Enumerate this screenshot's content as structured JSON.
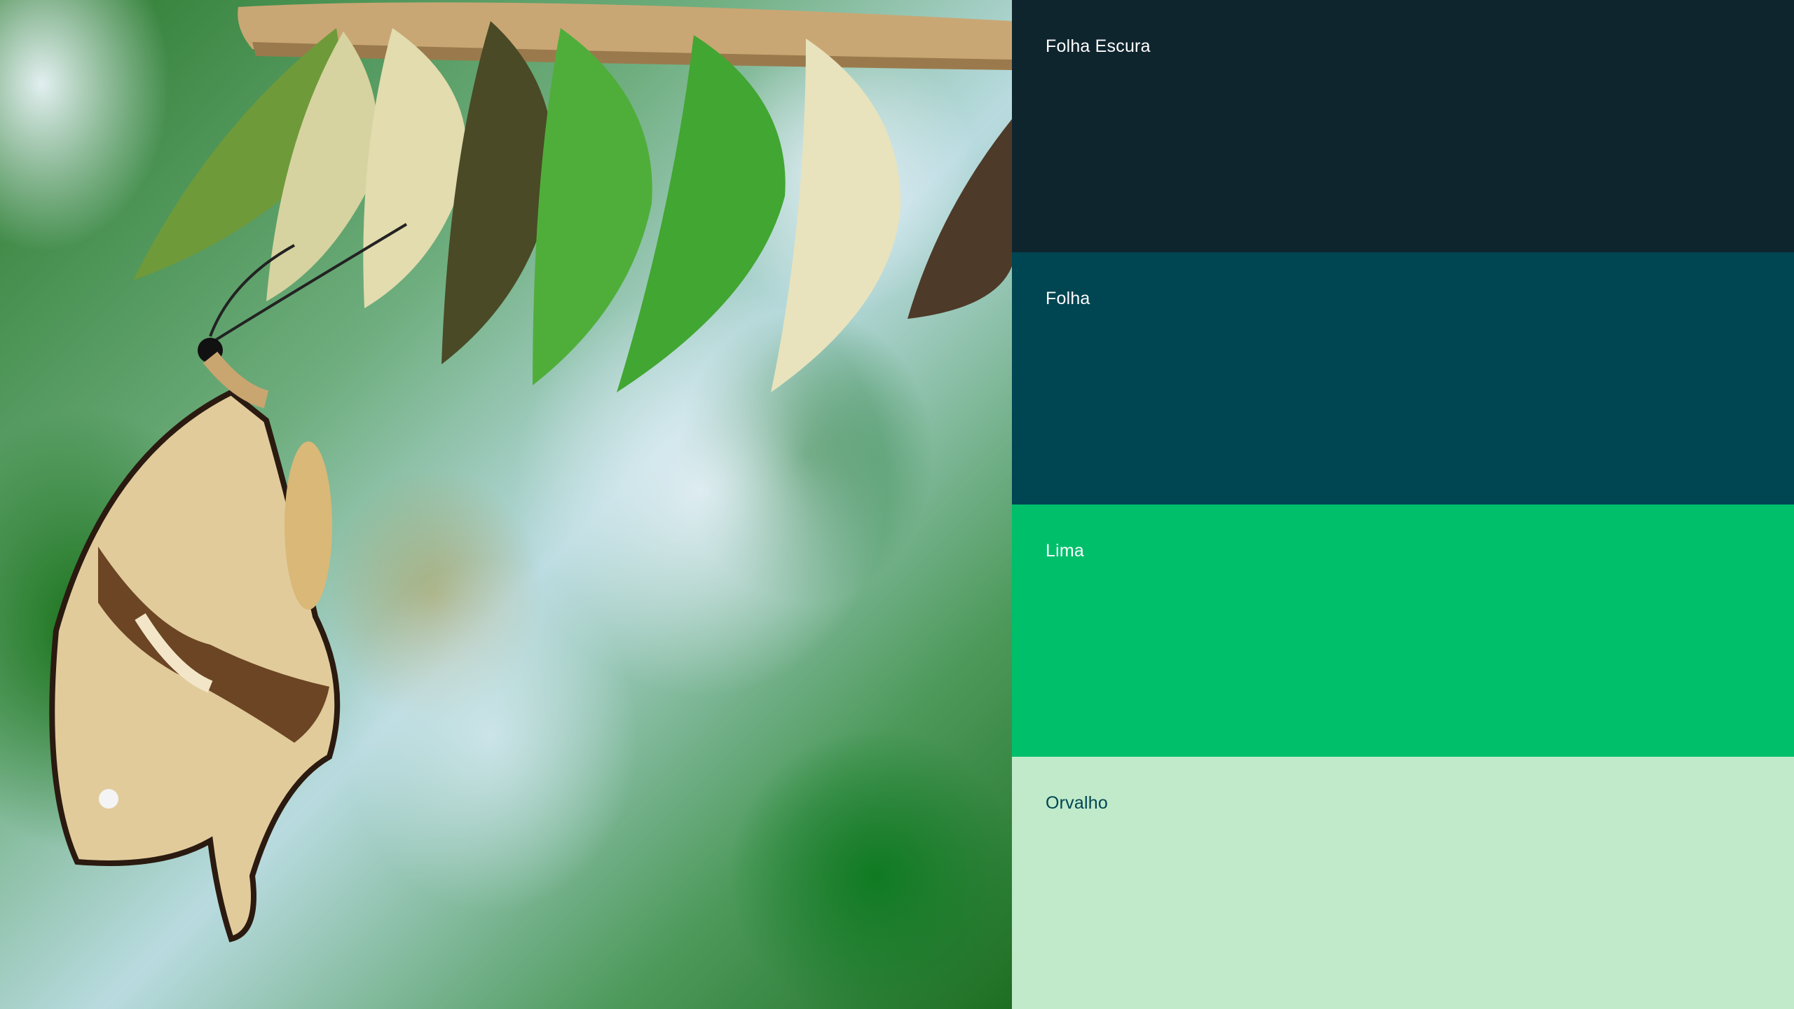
{
  "photo": {
    "subject_icon": "butterfly-emerging-from-chrysalis"
  },
  "palette": {
    "swatches": [
      {
        "name": "Folha Escura",
        "color": "#0f252e",
        "text_color": "#ffffff"
      },
      {
        "name": "Folha",
        "color": "#004552",
        "text_color": "#ffffff"
      },
      {
        "name": "Lima",
        "color": "#00bf6b",
        "text_color": "#ffffff"
      },
      {
        "name": "Orvalho",
        "color": "#c0eac9",
        "text_color": "#004552"
      }
    ]
  }
}
